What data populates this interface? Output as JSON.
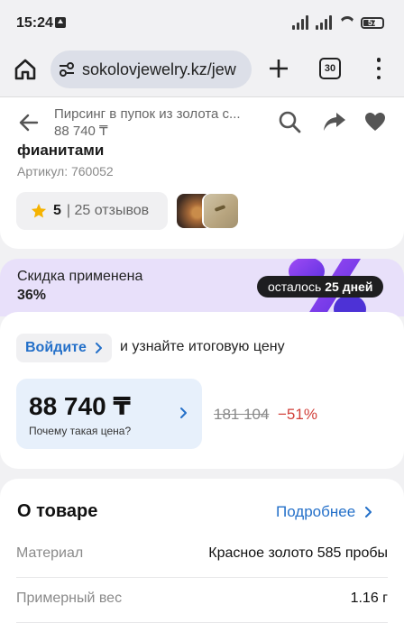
{
  "status_bar": {
    "time": "15:24",
    "battery": "57"
  },
  "browser": {
    "url": "sokolovjewelry.kz/jew",
    "tab_count": "30"
  },
  "header": {
    "title": "Пирсинг в пупок из золота с...",
    "price": "88 740 ₸"
  },
  "product": {
    "name_tail": "фианитами",
    "article": "Артикул: 760052",
    "rating": "5",
    "reviews": "| 25 отзывов"
  },
  "promo": {
    "title": "Скидка применена",
    "percent": "36%",
    "badge_prefix": "осталось",
    "badge_days": "25 дней",
    "graphic_color": "#7b3ff2"
  },
  "price": {
    "login_label": "Войдите",
    "login_rest": "и узнайте итоговую цену",
    "current": "88 740 ₸",
    "why": "Почему такая цена?",
    "old": "181 104",
    "discount": "−51%"
  },
  "about": {
    "title": "О товаре",
    "more": "Подробнее",
    "rows": [
      {
        "key": "Материал",
        "value": "Красное золото 585 пробы"
      },
      {
        "key": "Примерный вес",
        "value": "1.16 г"
      }
    ]
  },
  "colors": {
    "accent_blue": "#2470c9",
    "discount_red": "#d2403a",
    "star": "#f5b301"
  }
}
